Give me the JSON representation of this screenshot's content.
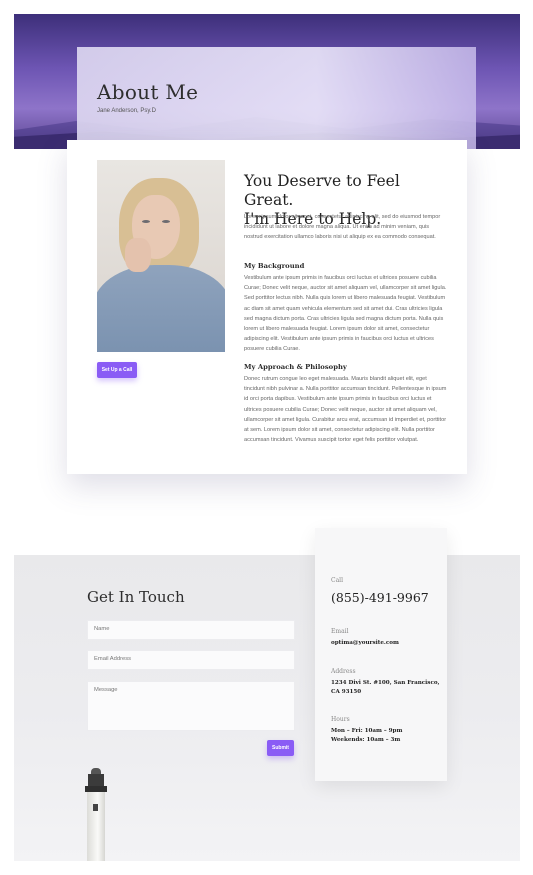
{
  "hero": {
    "title": "About Me",
    "subtitle": "Jane Anderson, Psy.D"
  },
  "about": {
    "heading_line1": "You Deserve to Feel Great.",
    "heading_line2": "I'm Here to Help.",
    "intro": "Lorem ipsum dolor sit amet, consectetur adipiscing elit, sed do eiusmod tempor incididunt ut labore et dolore magna aliqua. Ut enim ad minim veniam, quis nostrud exercitation ullamco laboris nisi ut aliquip ex ea commodo consequat.",
    "background_heading": "My Background",
    "background_text": "Vestibulum ante ipsum primis in faucibus orci luctus et ultrices posuere cubilia Curae; Donec velit neque, auctor sit amet aliquam vel, ullamcorper sit amet ligula. Sed porttitor lectus nibh. Nulla quis lorem ut libero malesuada feugiat. Vestibulum ac diam sit amet quam vehicula elementum sed sit amet dui. Cras ultricies ligula sed magna dictum porta. Cras ultricies ligula sed magna dictum porta. Nulla quis lorem ut libero malesuada feugiat. Lorem ipsum dolor sit amet, consectetur adipiscing elit. Vestibulum ante ipsum primis in faucibus orci luctus et ultrices posuere cubilia Curae.",
    "approach_heading": "My Approach & Philosophy",
    "approach_text": "Donec rutrum congue leo eget malesuada. Mauris blandit aliquet elit, eget tincidunt nibh pulvinar a. Nulla porttitor accumsan tincidunt. Pellentesque in ipsum id orci porta dapibus. Vestibulum ante ipsum primis in faucibus orci luctus et ultrices posuere cubilia Curae; Donec velit neque, auctor sit amet aliquam vel, ullamcorper sit amet ligula. Curabitur arcu erat, accumsan id imperdiet et, porttitor at sem. Lorem ipsum dolor sit amet, consectetur adipiscing elit. Nulla porttitor accumsan tincidunt. Vivamus suscipit tortor eget felis porttitor volutpat.",
    "cta_label": "Set Up a Call"
  },
  "contact": {
    "title": "Get In Touch",
    "name_placeholder": "Name",
    "email_placeholder": "Email Address",
    "message_placeholder": "Message",
    "submit_label": "Submit"
  },
  "info": {
    "call_label": "Call",
    "phone": "(855)-491-9967",
    "email_label": "Email",
    "email": "optima@yoursite.com",
    "address_label": "Address",
    "address": "1234 Divi St. #100, San Francisco, CA 93150",
    "hours_label": "Hours",
    "hours_line1": "Mon – Fri: 10am – 9pm",
    "hours_line2": "Weekends: 10am – 3m"
  },
  "colors": {
    "accent": "#8a5cf5",
    "hero_purple": "#6d55b3"
  }
}
